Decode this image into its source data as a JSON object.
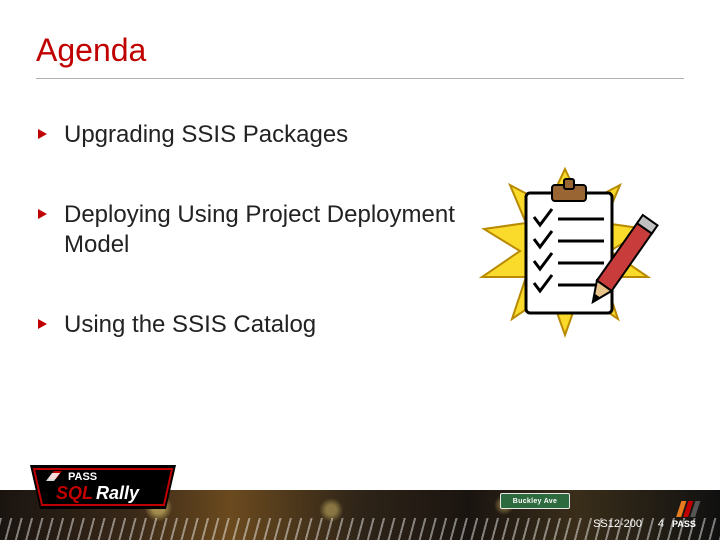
{
  "title": "Agenda",
  "bullets": [
    "Upgrading SSIS Packages",
    "Deploying Using Project Deployment Model",
    "Using the SSIS Catalog"
  ],
  "footer": {
    "session_code": "SS12-200",
    "page_number": "4",
    "sign_text": "Buckley Ave",
    "sqlrally": {
      "pass": "PASS",
      "sql": "SQL",
      "rally": "Rally"
    },
    "pass": {
      "label": "PASS"
    }
  }
}
